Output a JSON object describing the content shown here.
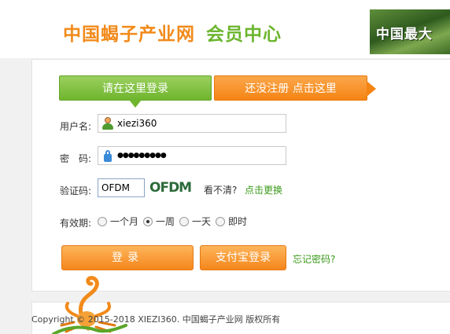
{
  "header": {
    "site_name": "中国蝎子产业网",
    "section_name": "会员中心",
    "banner_text": "中国最大"
  },
  "tabs": {
    "login": "请在这里登录",
    "register": "还没注册 点击这里"
  },
  "form": {
    "username_label": "用户名:",
    "username_value": "xiezi360",
    "password_label": "密　码:",
    "password_value": "●●●●●●●●●",
    "captcha_label": "验证码:",
    "captcha_value": "OFDM",
    "captcha_image_text": "OFDM",
    "captcha_hint": "看不清?",
    "captcha_refresh": "点击更换",
    "validity_label": "有效期:",
    "validity_options": [
      "一个月",
      "一周",
      "一天",
      "即时"
    ],
    "validity_selected": "一周"
  },
  "buttons": {
    "login": "登录",
    "alipay_login": "支付宝登录",
    "forgot_password": "忘记密码?"
  },
  "footer": {
    "copyright": "Copyright © 2015-2018 XIEZI360. 中国蝎子产业网 版权所有"
  },
  "colors": {
    "orange": "#f48413",
    "green": "#6fb52e"
  }
}
